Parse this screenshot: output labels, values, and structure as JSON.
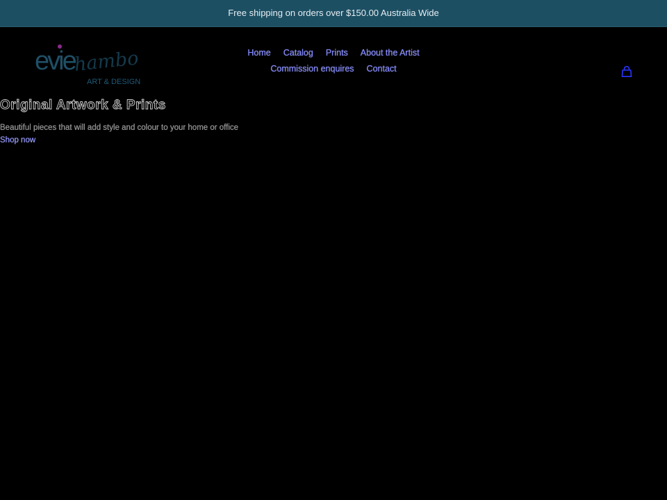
{
  "announcement": {
    "text": "Free shipping on orders over $150.00 Australia Wide"
  },
  "logo": {
    "word1": "evie",
    "word2": "hambo",
    "tagline": "ART & DESIGN",
    "color_primary": "#1f4f66",
    "color_dot": "#8a2a8c"
  },
  "nav": {
    "items": [
      {
        "label": "Home"
      },
      {
        "label": "Catalog"
      },
      {
        "label": "Prints"
      },
      {
        "label": "About the Artist"
      },
      {
        "label": "Commission enquires"
      },
      {
        "label": "Contact"
      }
    ],
    "cart_icon": "cart-icon"
  },
  "hero": {
    "title": "Original Artwork & Prints",
    "subtitle": "Beautiful pieces that will add style and colour to your home or office",
    "cta_label": "Shop now"
  },
  "colors": {
    "announcement_bg": "#1d4f63",
    "link": "#7c83ff",
    "background": "#000000"
  }
}
